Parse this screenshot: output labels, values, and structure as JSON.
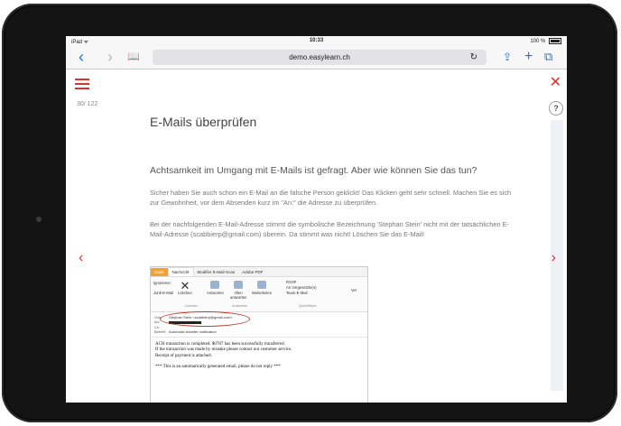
{
  "device": {
    "name": "iPad"
  },
  "statusbar": {
    "carrier": "iPad ᯤ",
    "time": "10:33",
    "battery": "100 %"
  },
  "browser": {
    "back_icon": "‹",
    "forward_icon": "›",
    "bookmarks_icon": "📖",
    "url": "demo.easylearn.ch",
    "reload_icon": "↻",
    "share_icon": "⇪",
    "add_icon": "+",
    "tabs_icon": "⧉"
  },
  "page": {
    "menu_icon": "hamburger-icon",
    "counter": "30/ 122",
    "close_icon": "✕",
    "help_label": "?",
    "prev_icon": "‹",
    "next_icon": "›",
    "title": "E-Mails überprüfen",
    "heading": "Achtsamkeit im Umgang mit E-Mails ist gefragt. Aber wie können Sie das tun?",
    "paragraph1": "Sicher haben Sie auch schon ein E-Mail an die falsche Person geklickt! Das Klicken geht sehr schnell. Machen Sie es sich zur Gewohnheit, vor dem Absenden kurz im \"An:\" die Adresse zu überprüfen.",
    "paragraph2": "Bei der nachfolgenden E-Mail-Adresse stimmt die symbolische Bezeichnung 'Stephan Stein' nicht mit der tatsächlichen E-Mail-Adresse (scabbierp@gmail.com) überein. Da stimmt was nicht! Löschen Sie das E-Mail!"
  },
  "email": {
    "tabs": [
      "Datei",
      "Nachricht",
      "Modifier E-Mail-Scan",
      "Adobe PDF"
    ],
    "ribbon": {
      "ignore": "Ignorieren",
      "junk": "Junk-E-Mail",
      "delete": "Löschen",
      "reply": "Antworten",
      "reply_all": "Allen antworten",
      "forward": "Weiterleiten",
      "rssp": "RSSP",
      "manager": "An Vorgesetzte(n)",
      "team": "Team-E-Mail",
      "group_delete": "Löschen",
      "group_respond": "Antworten",
      "group_quick": "QuickSteps",
      "more": "Ver"
    },
    "header": {
      "from_label": "Von:",
      "from_value": "Stephan Stein <scabbierp@gmail.com>",
      "to_label": "An:",
      "cc_label": "Cc:",
      "subject_label": "Betreff:",
      "subject_value": "Automatic transfer notification"
    },
    "body_lines": [
      "ACH transaction is completed. $0787 has been successfully transferred.",
      "If the transaction was made by mistake please contact our customer service.",
      "Receipt of payment is attached.",
      "",
      "*** This is an automatically generated email, please do not reply ***"
    ]
  }
}
